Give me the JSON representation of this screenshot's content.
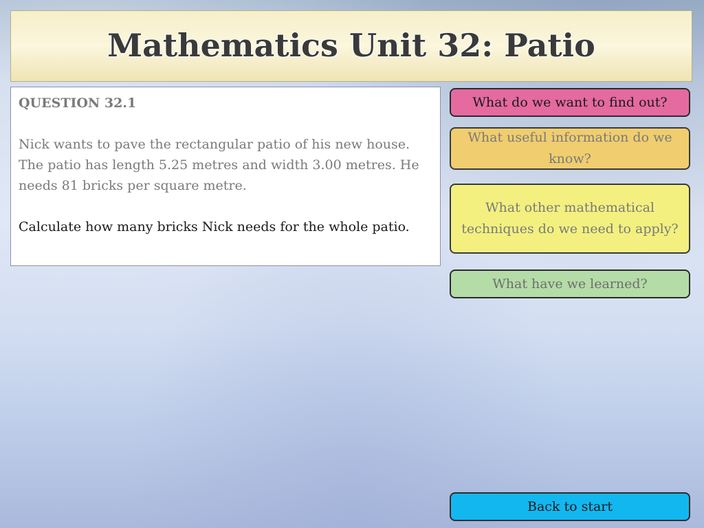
{
  "title": "Mathematics Unit 32: Patio",
  "question": {
    "heading": "QUESTION 32.1",
    "body": "Nick wants to pave the rectangular patio of his new house.  The patio has length 5.25 metres and width 3.00 metres.  He needs 81 bricks per square metre.",
    "task": "Calculate how many bricks Nick needs for the whole patio."
  },
  "buttons": {
    "find_out": "What do we want to find out?",
    "useful_info": "What useful information do we know?",
    "techniques": "What other mathematical techniques do we need to apply?",
    "learned": "What have we learned?",
    "back": "Back to start"
  },
  "colors": {
    "find_out": "#e46aa0",
    "useful_info": "#f0cd6e",
    "techniques": "#f3f080",
    "learned": "#b4dca7",
    "back": "#13b7f0"
  }
}
